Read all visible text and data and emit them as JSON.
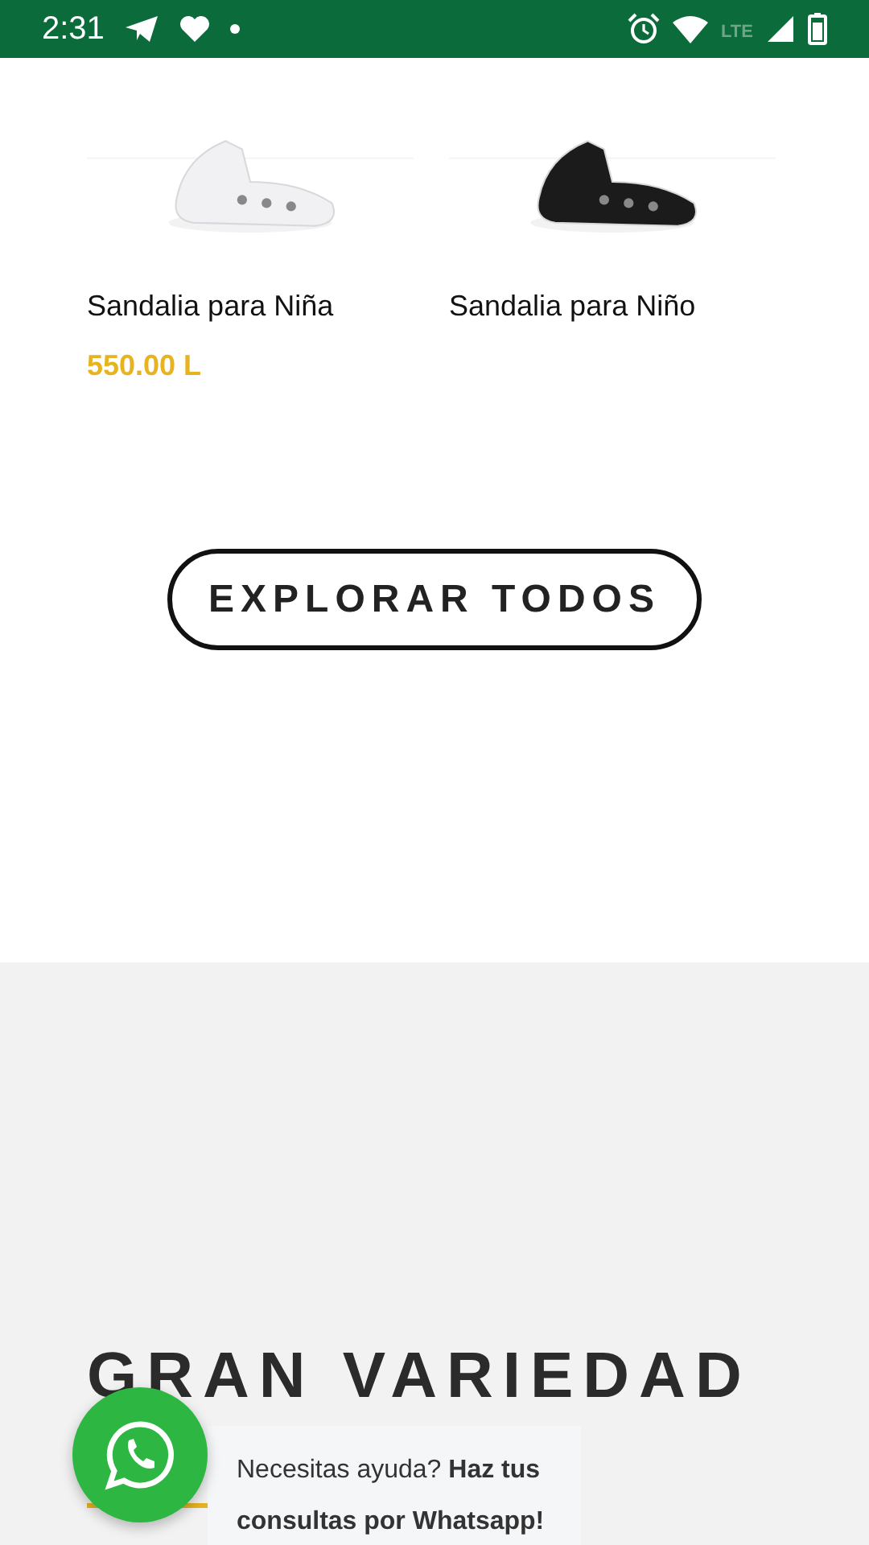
{
  "status_bar": {
    "time": "2:31",
    "network": "LTE"
  },
  "products": [
    {
      "name": "Sandalia para Niña",
      "price": "550.00 L",
      "kind": "light"
    },
    {
      "name": "Sandalia para Niño",
      "kind": "dark"
    }
  ],
  "explore_button": {
    "label": "EXPLORAR TODOS"
  },
  "section": {
    "heading": "GRAN VARIEDAD"
  },
  "whatsapp": {
    "message": "Necesitas ayuda? **Haz tus consultas por Whatsapp!**"
  }
}
